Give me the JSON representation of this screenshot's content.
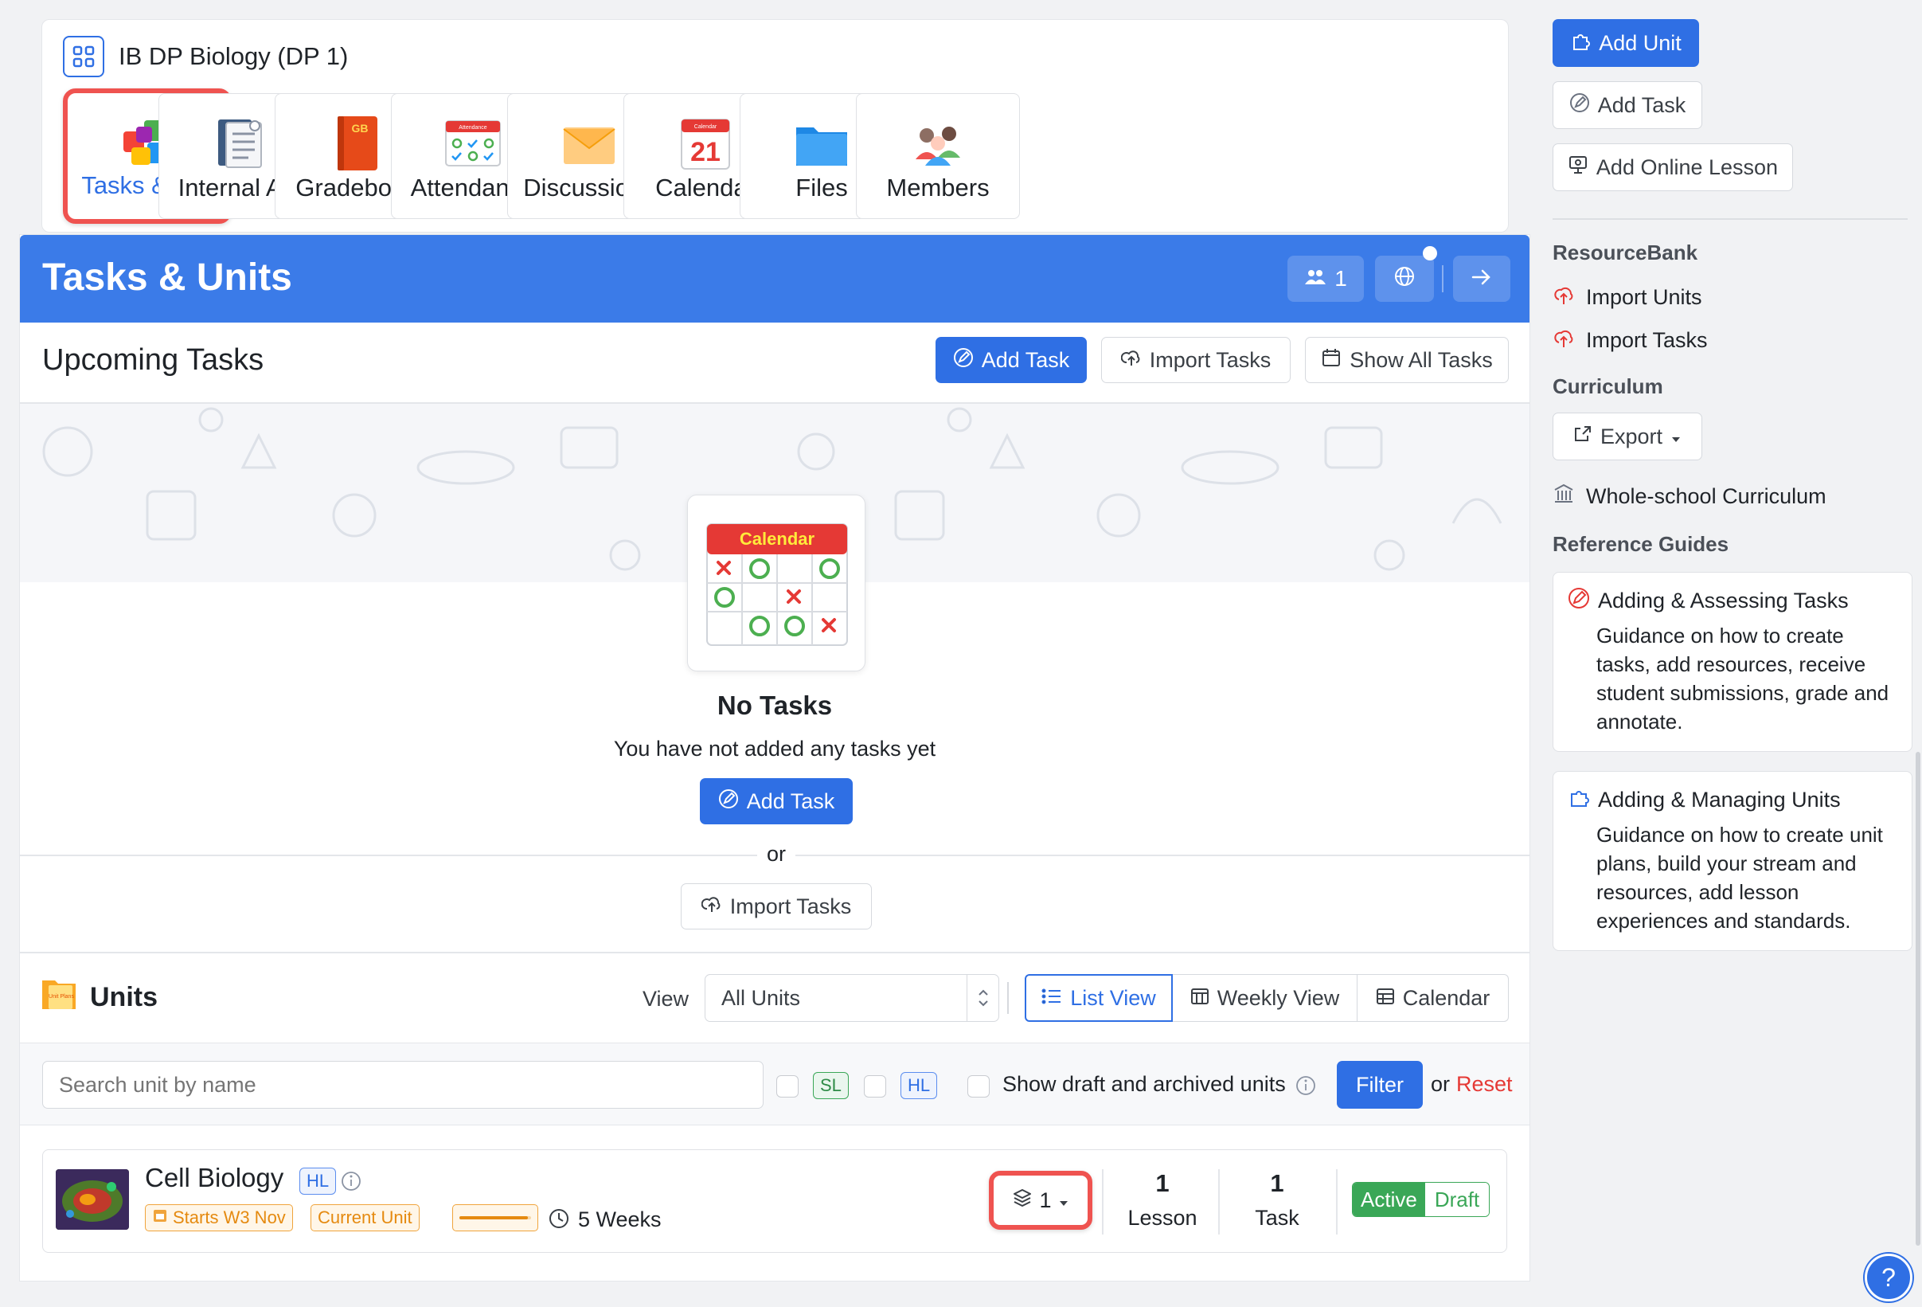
{
  "course": {
    "title": "IB DP Biology (DP 1)"
  },
  "tools": [
    {
      "label": "Tasks & U...",
      "icon": "puzzle-icon"
    },
    {
      "label": "Internal A...",
      "icon": "internal-assessment-icon"
    },
    {
      "label": "Gradebook",
      "icon": "gradebook-icon",
      "badge": "GB"
    },
    {
      "label": "Attendance",
      "icon": "attendance-icon",
      "badge": "Attendance"
    },
    {
      "label": "Discussions",
      "icon": "envelope-icon"
    },
    {
      "label": "Calendar",
      "icon": "calendar-icon",
      "day": "21",
      "badge": "Calendar"
    },
    {
      "label": "Files",
      "icon": "folder-icon"
    },
    {
      "label": "Members",
      "icon": "people-icon"
    }
  ],
  "banner": {
    "title": "Tasks & Units",
    "members_count": "1"
  },
  "upcoming": {
    "title": "Upcoming Tasks",
    "add_task": "Add Task",
    "import_tasks": "Import Tasks",
    "show_all": "Show All Tasks",
    "empty_icon_label": "Calendar",
    "empty_title": "No Tasks",
    "empty_subtitle": "You have not added any tasks yet",
    "empty_add_task": "Add Task",
    "or": "or",
    "empty_import": "Import Tasks"
  },
  "units": {
    "title": "Units",
    "icon_label": "Unit Plans",
    "view_label": "View",
    "view_select": "All Units",
    "view_buttons": [
      "List View",
      "Weekly View",
      "Calendar"
    ],
    "search_placeholder": "Search unit by name",
    "tag_sl": "SL",
    "tag_hl": "HL",
    "show_draft": "Show draft and archived units",
    "filter": "Filter",
    "or": "or",
    "reset": "Reset",
    "items": [
      {
        "name": "Cell Biology",
        "level": "HL",
        "starts": "Starts W3 Nov",
        "status": "Current Unit",
        "progress": 0.95,
        "duration": "5 Weeks",
        "layers": "1",
        "lessons_count": "1",
        "lessons_label": "Lesson",
        "tasks_count": "1",
        "tasks_label": "Task",
        "state_active": "Active",
        "state_draft": "Draft"
      }
    ]
  },
  "sidebar": {
    "add_unit": "Add Unit",
    "add_task": "Add Task",
    "add_online_lesson": "Add Online Lesson",
    "resourcebank_heading": "ResourceBank",
    "import_units": "Import Units",
    "import_tasks": "Import Tasks",
    "curriculum_heading": "Curriculum",
    "export": "Export",
    "whole_school": "Whole-school Curriculum",
    "guides_heading": "Reference Guides",
    "guides": [
      {
        "title": "Adding & Assessing Tasks",
        "desc": "Guidance on how to create tasks, add resources, receive student submissions, grade and annotate."
      },
      {
        "title": "Adding & Managing Units",
        "desc": "Guidance on how to create unit plans, build your stream and resources, add lesson experiences and standards."
      }
    ]
  },
  "help": "?",
  "colors": {
    "accent": "#2f6fe4",
    "banner": "#3b7be8",
    "highlight": "#ef5350",
    "reset": "#e53935",
    "active": "#3aa757",
    "orange": "#f0a43c"
  }
}
